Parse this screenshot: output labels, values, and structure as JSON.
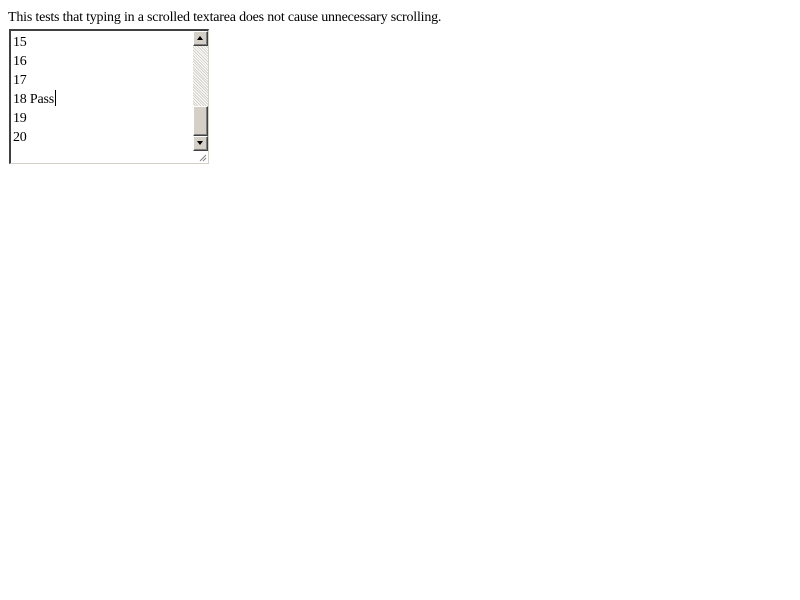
{
  "page": {
    "description": "This tests that typing in a scrolled textarea does not cause unnecessary scrolling."
  },
  "textarea": {
    "visible_lines": [
      "15",
      "16",
      "17",
      "18 Pass",
      "19",
      "20"
    ],
    "caret_line": 3
  },
  "icons": {
    "scroll_up": "arrow-up-icon",
    "scroll_down": "arrow-down-icon",
    "resize": "resize-grip-icon"
  },
  "colors": {
    "background": "#ffffff",
    "text": "#000000",
    "scrollbar_face": "#d4d0c8"
  }
}
